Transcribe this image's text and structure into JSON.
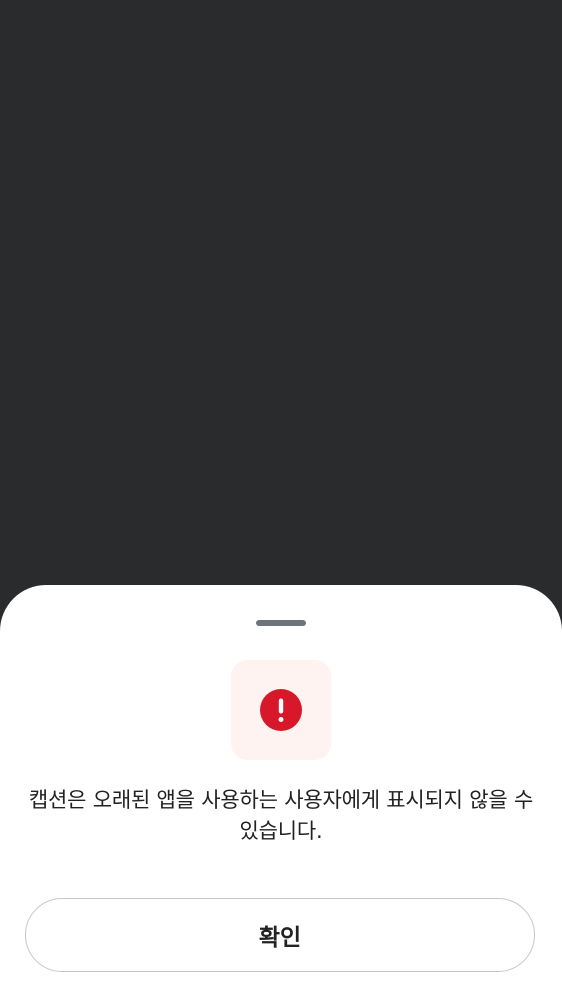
{
  "sheet": {
    "message": "캡션은 오래된 앱을 사용하는 사용자에게 표시되지 않을 수 있습니다.",
    "confirm_label": "확인",
    "icon": "alert-circle-icon"
  },
  "colors": {
    "backdrop": "#2a2b2d",
    "sheet_background": "#ffffff",
    "icon_tile": "#fff3f2",
    "alert_red": "#d7182a",
    "handle": "#6f7479",
    "text": "#222222",
    "button_border": "#c5c7ca"
  }
}
